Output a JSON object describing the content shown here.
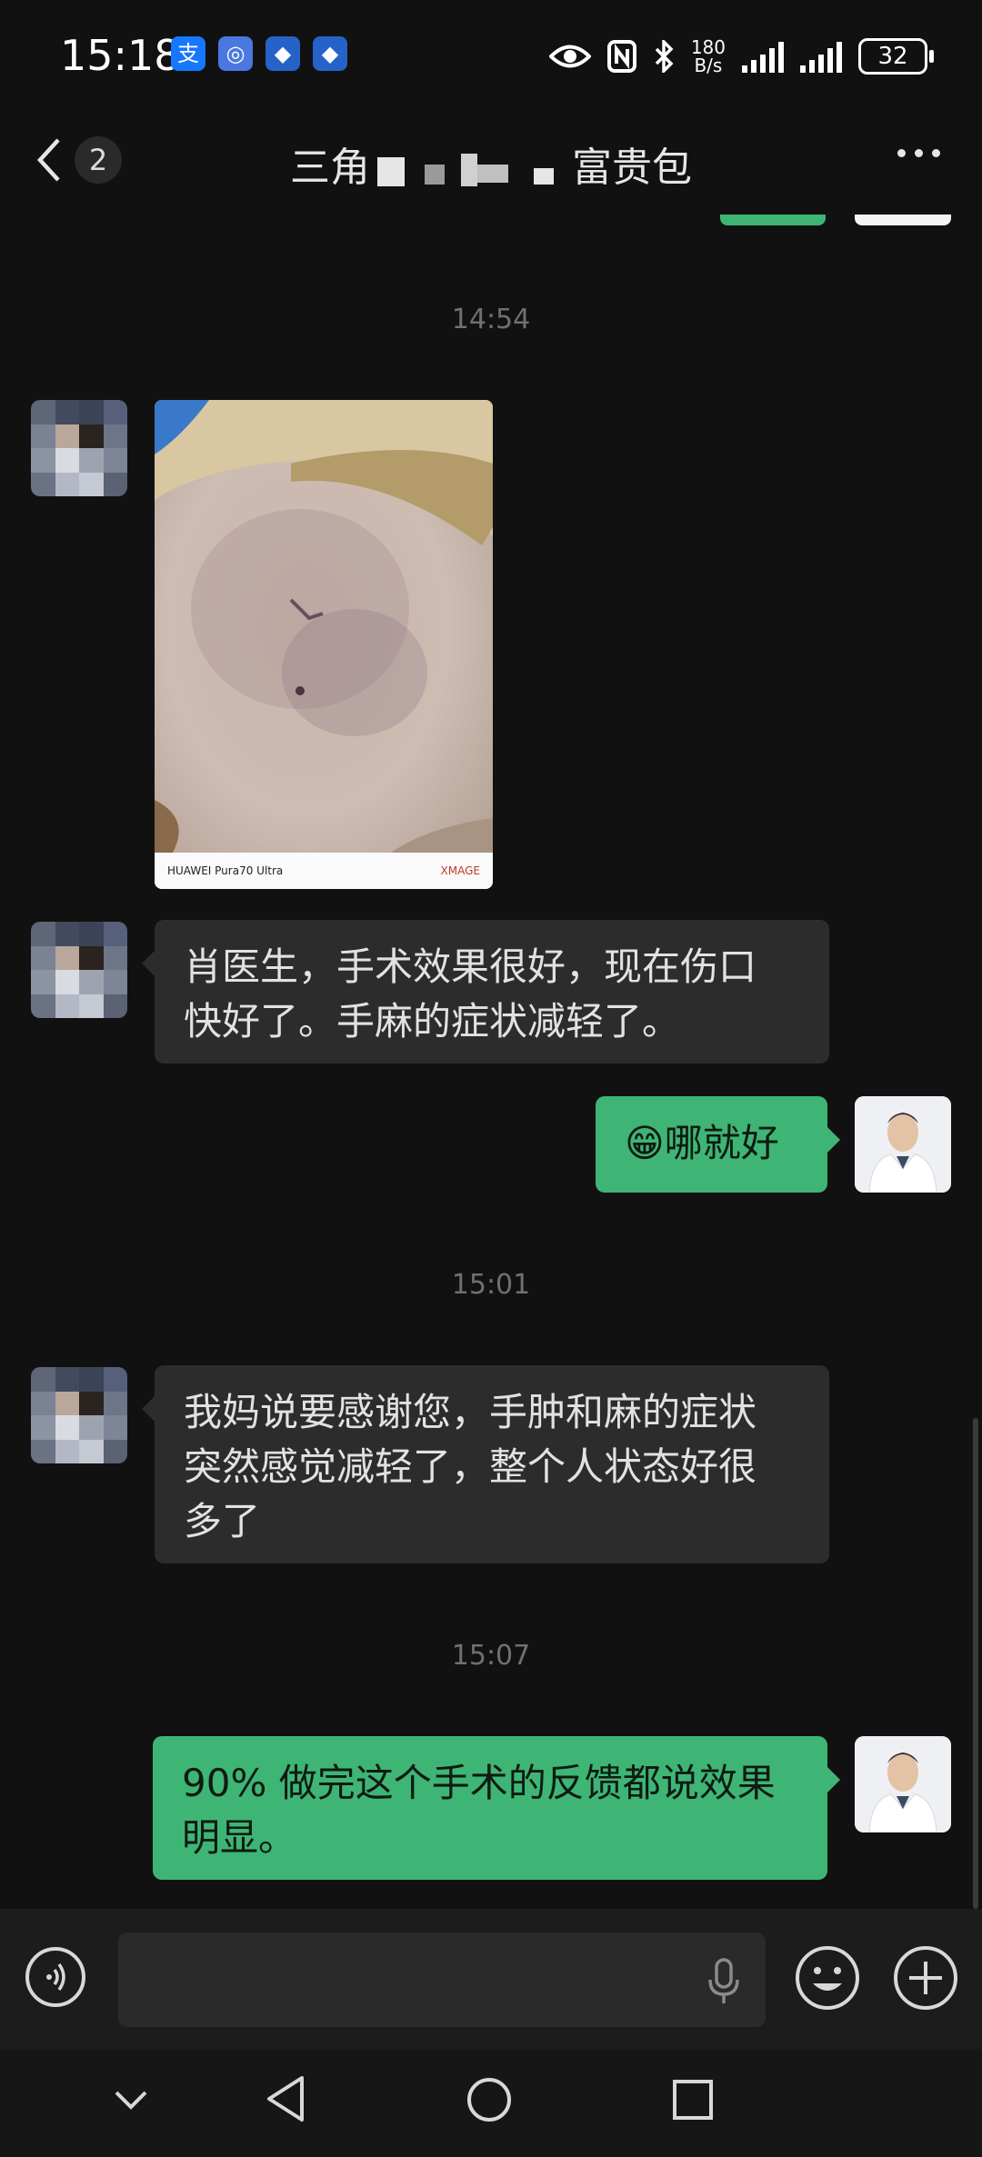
{
  "status_bar": {
    "time": "15:18",
    "network_speed_value": "180",
    "network_speed_unit": "B/s",
    "battery": "32",
    "app_icons": [
      "alipay-icon",
      "app-icon",
      "bank-icon",
      "bank-icon"
    ]
  },
  "header": {
    "back_label": "<",
    "unread_count": "2",
    "title_start": "三角",
    "title_end": "富贵包"
  },
  "messages": [
    {
      "type": "timestamp",
      "text": "14:54"
    },
    {
      "type": "image",
      "side": "left",
      "watermark_left": "HUAWEI Pura70 Ultra",
      "watermark_right": "XMAGE"
    },
    {
      "type": "text",
      "side": "left",
      "lines": [
        "肖医生，手术效果很好，现在伤口",
        "快好了。手麻的症状减轻了。"
      ]
    },
    {
      "type": "text",
      "side": "right",
      "emoji": "😁",
      "text": "哪就好"
    },
    {
      "type": "timestamp",
      "text": "15:01"
    },
    {
      "type": "text",
      "side": "left",
      "lines": [
        "我妈说要感谢您，手肿和麻的症状",
        "突然感觉减轻了，整个人状态好很",
        "多了"
      ]
    },
    {
      "type": "timestamp",
      "text": "15:07"
    },
    {
      "type": "text",
      "side": "right",
      "lines": [
        "90% 做完这个手术的反馈都说效果",
        "明显。"
      ]
    }
  ],
  "input_bar": {
    "placeholder": ""
  },
  "colors": {
    "background": "#111111",
    "incoming_bubble": "#2c2c2c",
    "outgoing_bubble": "#3eb575",
    "timestamp": "#707070"
  },
  "icons": {
    "voice": "voice-icon",
    "mic": "mic-icon",
    "emoji": "emoji-icon",
    "plus": "plus-icon",
    "more": "more-icon",
    "nav_down": "chevron-down-icon",
    "nav_back": "triangle-back-icon",
    "nav_home": "circle-home-icon",
    "nav_recent": "square-recent-icon"
  }
}
